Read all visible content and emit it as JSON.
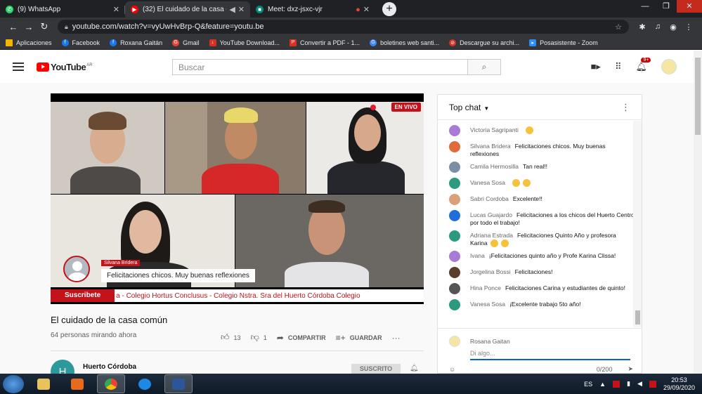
{
  "browser": {
    "tabs": [
      {
        "title": "(9) WhatsApp",
        "icon": "whatsapp-icon",
        "color": "#25d366",
        "active": false
      },
      {
        "title": "(32) El cuidado de la casa co",
        "icon": "youtube-icon",
        "color": "#ff0000",
        "active": true
      },
      {
        "title": "Meet: dxz-jsxc-vjr",
        "icon": "meet-icon",
        "color": "#00897b",
        "active": false
      }
    ],
    "url": "youtube.com/watch?v=vyUwHvBrp-Q&feature=youtu.be",
    "bookmarks": [
      {
        "label": "Aplicaciones",
        "color": "#f4b400"
      },
      {
        "label": "Facebook",
        "color": "#1877f2"
      },
      {
        "label": "Roxana Gaitán",
        "color": "#1877f2"
      },
      {
        "label": "Gmail",
        "color": "#ea4335"
      },
      {
        "label": "YouTube Download...",
        "color": "#d93025"
      },
      {
        "label": "Convertir a PDF - 1...",
        "color": "#d93025"
      },
      {
        "label": "boletines web santi...",
        "color": "#4285f4"
      },
      {
        "label": "Descargue su archi...",
        "color": "#d93025"
      },
      {
        "label": "Posasistente - Zoom",
        "color": "#2d8cff"
      }
    ]
  },
  "youtube": {
    "logo_text": "YouTube",
    "region": "AR",
    "search_placeholder": "Buscar",
    "notification_count": "9+"
  },
  "video": {
    "live_label": "EN VIVO",
    "overlay_name": "Silvana Bridera",
    "overlay_comment": "Felicitaciones chicos. Muy buenas reflexiones",
    "subscribe_label": "Suscribete",
    "ticker_text": "a - Colegio Hortus Conclusus - Colegio Nstra. Sra del Huerto Córdoba     Colegio",
    "title": "El cuidado de la casa común",
    "viewers": "64 personas mirando ahora",
    "likes": "13",
    "dislikes": "1",
    "share_label": "COMPARTIR",
    "save_label": "GUARDAR",
    "channel_initial": "H",
    "channel_name": "Huerto Córdoba",
    "subscribed_label": "SUSCRITO"
  },
  "chat": {
    "header": "Top chat",
    "messages": [
      {
        "author": "Victoria Sagripanti",
        "text": "",
        "emoji": 1,
        "color": "#a97ad6"
      },
      {
        "author": "Silvana Bridera",
        "text": "Felicitaciones chicos. Muy buenas reflexiones",
        "emoji": 0,
        "color": "#e06a3a"
      },
      {
        "author": "Camila Hermosilla",
        "text": "Tan real!!",
        "emoji": 0,
        "color": "#7b8fa3"
      },
      {
        "author": "Vanesa Sosa",
        "text": "",
        "emoji": 2,
        "color": "#2c9a7f"
      },
      {
        "author": "Sabri Cordoba",
        "text": "Excelente!!",
        "emoji": 0,
        "color": "#d9a07a"
      },
      {
        "author": "Lucas Guajardo",
        "text": "Felicitaciones a los chicos del Huerto Centro por todo el trabajo!",
        "emoji": 0,
        "color": "#1e6fd9"
      },
      {
        "author": "Adriana Estrada",
        "text": "Felicitaciones Quinto Año y profesora Karina",
        "emoji": 2,
        "color": "#2c9a7f"
      },
      {
        "author": "Ivana",
        "text": "¡Felicitaciones quinto año y Profe Karina Clissa!",
        "emoji": 0,
        "color": "#a97ad6"
      },
      {
        "author": "Jorgelina Bossi",
        "text": "Felicitaciones!",
        "emoji": 0,
        "color": "#5a3e2b"
      },
      {
        "author": "Hina Ponce",
        "text": "Felicitaciones Carina y estudiantes de quinto!",
        "emoji": 0,
        "color": "#555"
      },
      {
        "author": "Vanesa Sosa",
        "text": "¡Excelente trabajo 5to año!",
        "emoji": 0,
        "color": "#2c9a7f"
      }
    ],
    "current_user": "Rosana Gaitan",
    "input_placeholder": "Di algo...",
    "char_count": "0/200"
  },
  "taskbar": {
    "lang": "ES",
    "time": "20:53",
    "date": "29/09/2020"
  }
}
